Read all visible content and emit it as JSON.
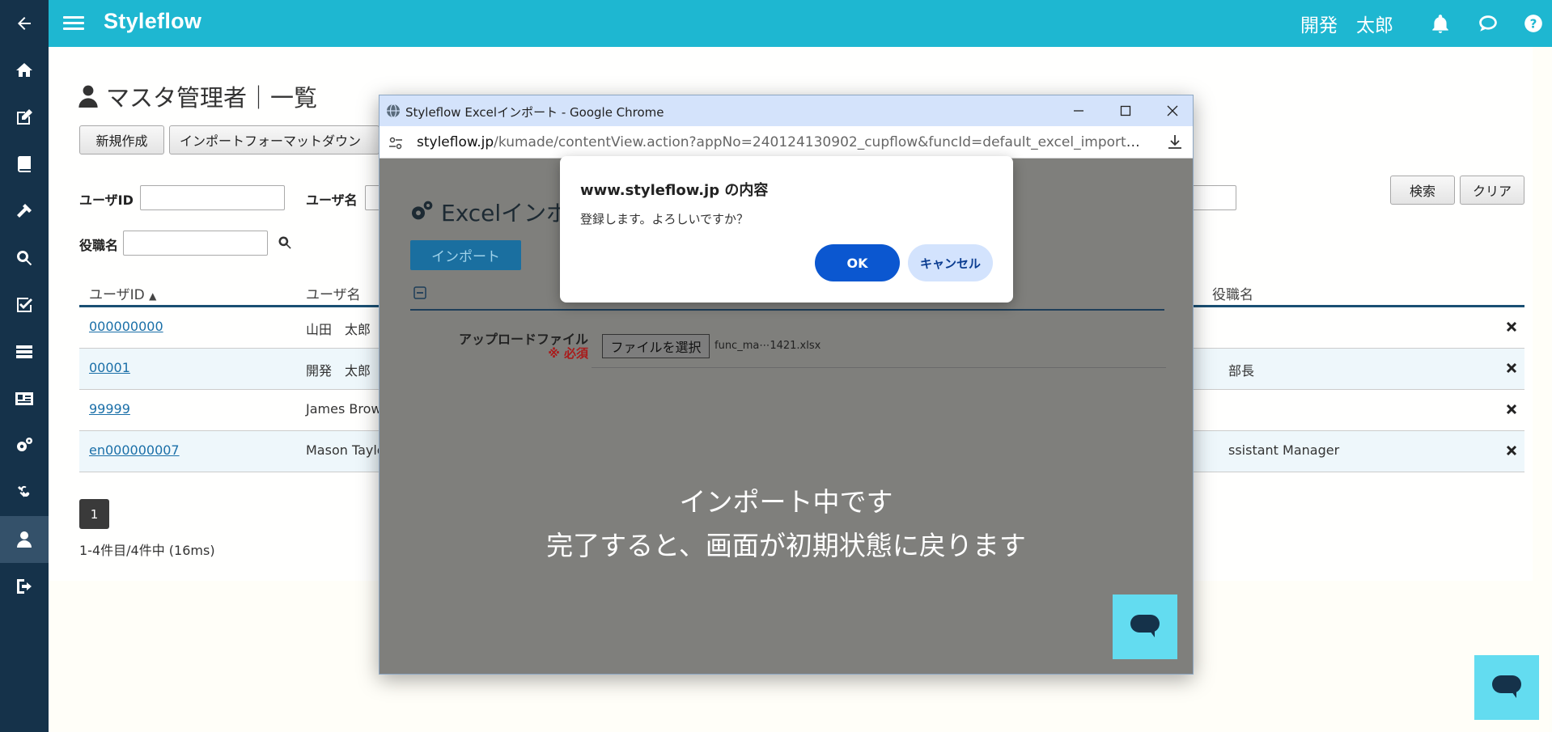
{
  "header": {
    "brand": "Styleflow",
    "user_name": "開発　太郎"
  },
  "sidebar": {
    "items": [
      {
        "icon": "back-arrow-icon"
      },
      {
        "icon": "home-icon"
      },
      {
        "icon": "edit-icon"
      },
      {
        "icon": "book-icon"
      },
      {
        "icon": "hammer-icon"
      },
      {
        "icon": "search-icon"
      },
      {
        "icon": "checkbox-icon"
      },
      {
        "icon": "list-icon"
      },
      {
        "icon": "id-card-icon"
      },
      {
        "icon": "gears-icon"
      },
      {
        "icon": "link-icon"
      },
      {
        "icon": "user-icon",
        "active": true
      },
      {
        "icon": "sign-out-icon"
      }
    ]
  },
  "page": {
    "title": "マスタ管理者｜一覧",
    "new_button": "新規作成",
    "import_format_button": "インポートフォーマットダウン",
    "search_button": "検索",
    "clear_button": "クリア",
    "filters": {
      "user_id_label": "ユーザID",
      "user_name_label": "ユーザ名",
      "position_label": "役職名"
    },
    "table": {
      "headers": [
        "ユーザID",
        "ユーザ名",
        "役職名"
      ],
      "sort_indicator": "▲",
      "rows": [
        {
          "user_id": "000000000",
          "user_name": "山田　太郎",
          "position": ""
        },
        {
          "user_id": "00001",
          "user_name": "開発　太郎",
          "position": "部長"
        },
        {
          "user_id": "99999",
          "user_name": "James Brow",
          "position": ""
        },
        {
          "user_id": "en000000007",
          "user_name": "Mason Taylo",
          "position": "ssistant Manager"
        }
      ]
    },
    "pager": "1",
    "count_text": "1-4件目/4件中 (16ms)"
  },
  "popup": {
    "window_title": "Styleflow Excelインポート - Google Chrome",
    "url_host": "styleflow.jp",
    "url_path": "/kumade/contentView.action?appNo=240124130902_cupflow&funcId=default_excel_import&type=RE...",
    "title": "Excelインポ",
    "import_button": "インポート",
    "upload_label": "アップロードファイル",
    "required_label": "※ 必須",
    "file_button": "ファイルを選択",
    "file_name": "func_ma⋯1421.xlsx",
    "loading_line1": "インポート中です",
    "loading_line2": "完了すると、画面が初期状態に戻ります"
  },
  "dialog": {
    "title": "www.styleflow.jp の内容",
    "message": "登録します。よろしいですか？",
    "ok": "OK",
    "cancel": "キャンセル"
  },
  "colors": {
    "header": "#1eb7d1",
    "sidebar": "#15324a",
    "ok_button": "#0b57d0",
    "chat": "#63dcf0"
  }
}
